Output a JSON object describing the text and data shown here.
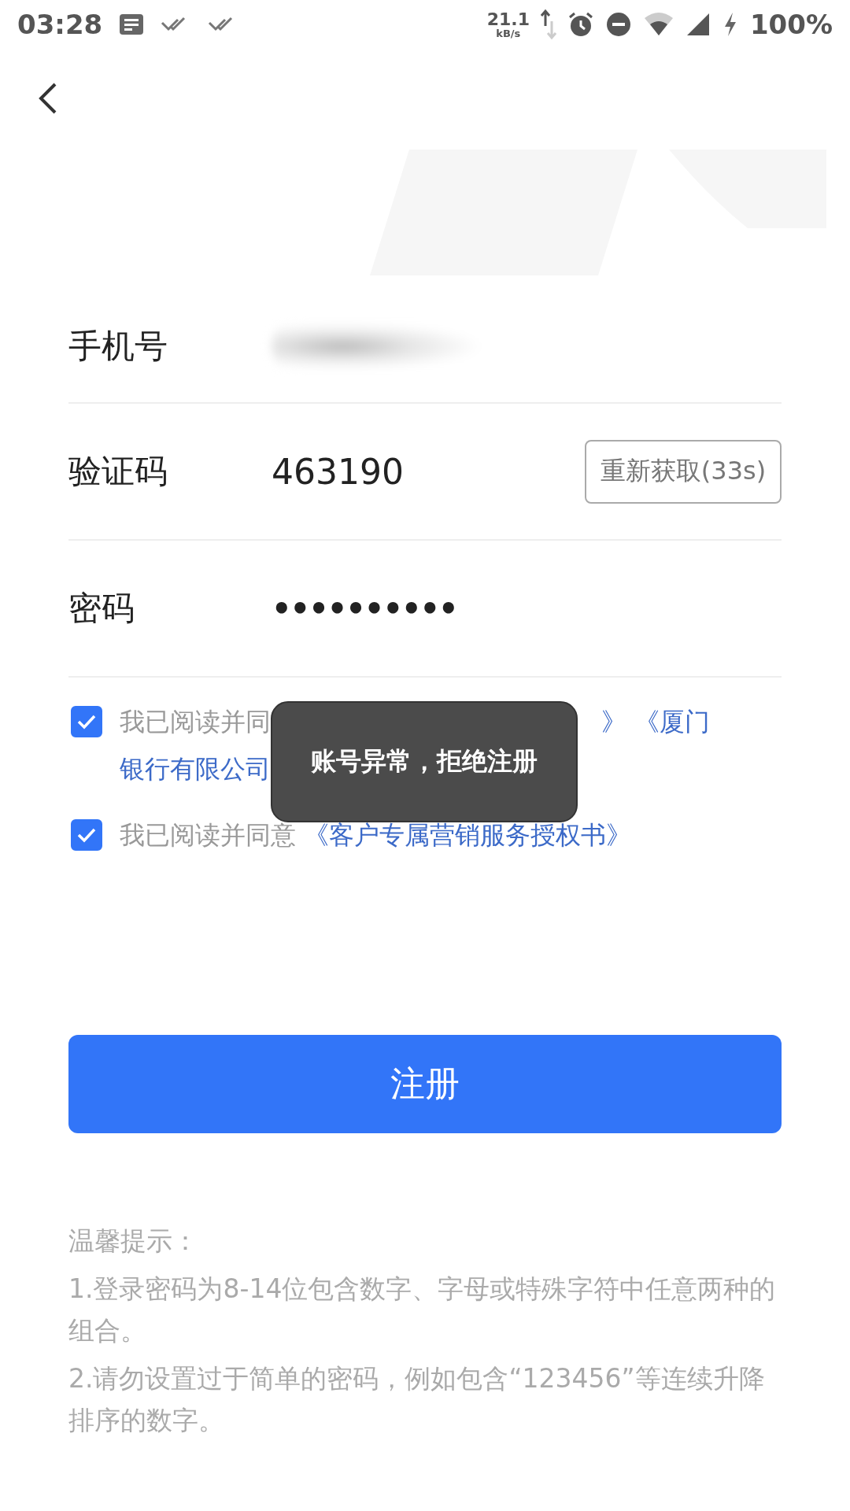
{
  "status_bar": {
    "time": "03:28",
    "speed": "21.1",
    "speed_unit": "kB/s",
    "battery": "100%"
  },
  "form": {
    "fields": [
      {
        "label": "手机号",
        "kind": "masked"
      },
      {
        "label": "验证码",
        "kind": "code",
        "value": "463190",
        "action": "重新获取(33s)"
      },
      {
        "label": "密码",
        "kind": "password",
        "value": "••••••••••"
      }
    ]
  },
  "agreements": [
    {
      "checked": true,
      "covered": true,
      "prefix": "我已阅读并同",
      "links": [
        "》",
        "《厦门",
        "银行有限公司"
      ]
    },
    {
      "checked": true,
      "prefix": "我已阅读并同意",
      "links": [
        "《客户专属营销服务授权书》"
      ]
    }
  ],
  "submit_button": "注册",
  "toast": "账号异常，拒绝注册",
  "tips": {
    "title": "温馨提示：",
    "items": [
      "1.登录密码为8-14位包含数字、字母或特殊字符中任意两种的组合。",
      "2.请勿设置过于简单的密码，例如包含“123456”等连续升降排序的数字。"
    ]
  }
}
